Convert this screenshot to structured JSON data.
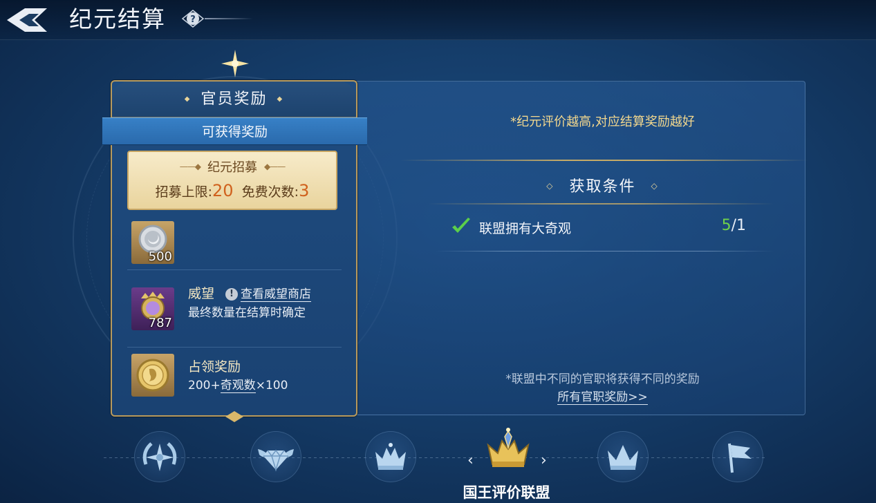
{
  "header": {
    "title": "纪元结算",
    "help_symbol": "?"
  },
  "card": {
    "title": "官员奖励",
    "ribbon": "可获得奖励",
    "recruit": {
      "title": "纪元招募",
      "limit_label": "招募上限:",
      "limit_value": "20",
      "free_label": "免费次数:",
      "free_value": "3"
    },
    "items": [
      {
        "icon": "silver-coin-icon",
        "count": "500"
      },
      {
        "icon": "prestige-medal-icon",
        "count": "787",
        "name": "威望",
        "link": "查看威望商店",
        "desc": "最终数量在结算时确定"
      },
      {
        "icon": "gold-coin-icon",
        "name": "占领奖励",
        "desc_prefix": "200+",
        "desc_link": "奇观数",
        "desc_suffix": "×100"
      }
    ]
  },
  "panel": {
    "tip_top": "*纪元评价越高,对应结算奖励越好",
    "condition_title": "获取条件",
    "condition": {
      "text": "联盟拥有大奇观",
      "done": "5",
      "total": "/1"
    },
    "tip_bottom": "*联盟中不同的官职将获得不同的奖励",
    "link_all": "所有官职奖励>>"
  },
  "tabs": {
    "items": [
      {
        "icon": "compass-laurel-icon"
      },
      {
        "icon": "winged-diamond-icon"
      },
      {
        "icon": "jeweled-crown-icon"
      },
      {
        "icon": "gold-crown-icon",
        "selected": true
      },
      {
        "icon": "silver-crown-icon"
      },
      {
        "icon": "flag-icon"
      }
    ],
    "selected_label": "国王评价联盟",
    "prev_arrow": "‹",
    "next_arrow": "›"
  },
  "colors": {
    "accent_gold": "#f3d88e",
    "done_green": "#6fd24a",
    "recruit_number": "#d0611d"
  }
}
